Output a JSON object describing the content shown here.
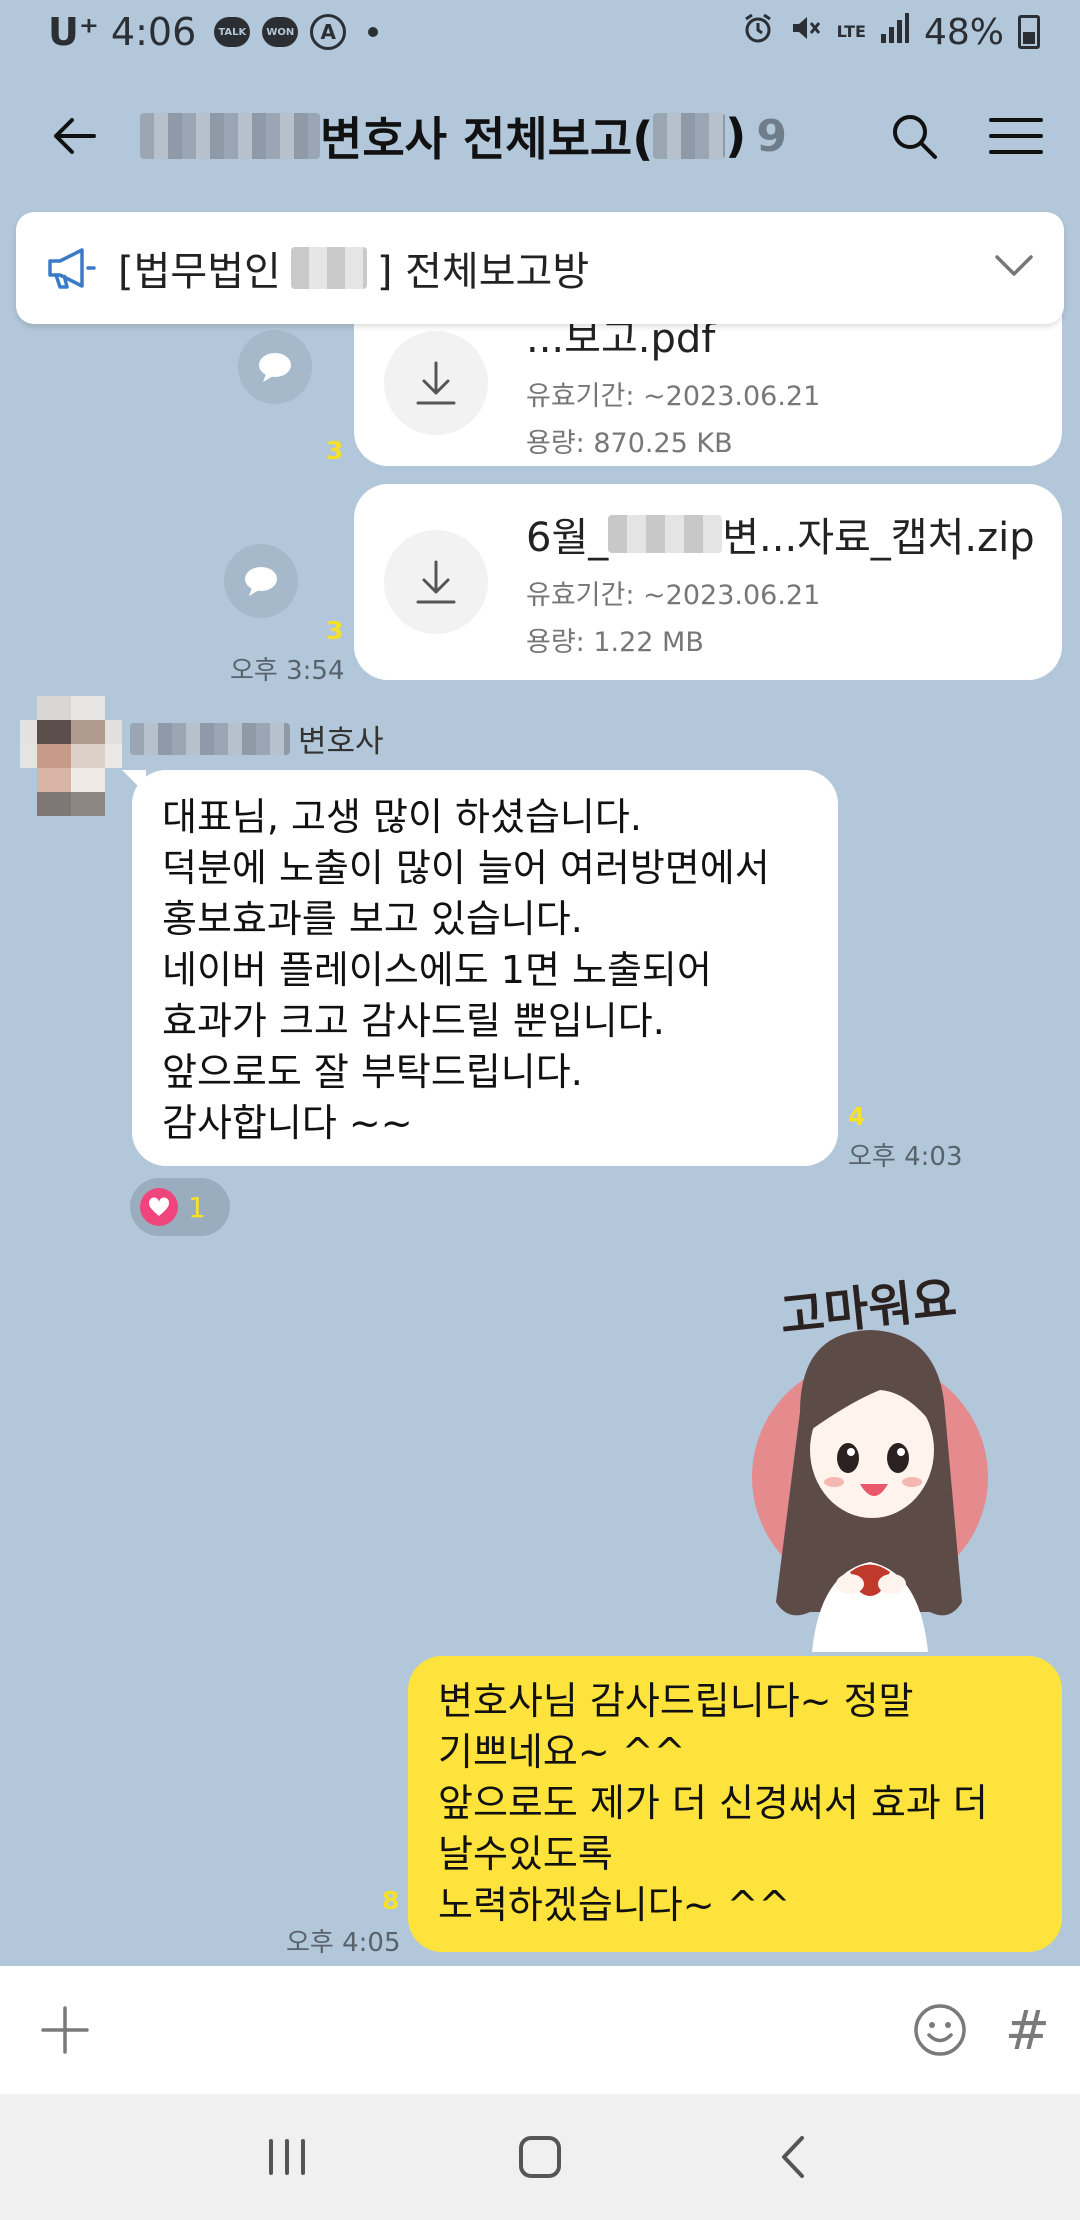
{
  "status": {
    "carrier": "U⁺",
    "time": "4:06",
    "talk_icon_label": "TALK",
    "won_icon_label": "WON",
    "a_icon_label": "A",
    "network": "LTE",
    "battery": "48%",
    "icons": [
      "alarm-icon",
      "mute-icon",
      "signal-icon",
      "battery-icon"
    ]
  },
  "header": {
    "title": "변호사 전체보고(",
    "title_close": ")",
    "member_count": "9",
    "icons": [
      "back-arrow-icon",
      "search-icon",
      "menu-icon"
    ]
  },
  "notice": {
    "prefix": "[법무법인",
    "suffix": "] 전체보고방",
    "icons": [
      "megaphone-icon",
      "chevron-down-icon"
    ]
  },
  "messages": {
    "file1": {
      "name_tail": "...보고.pdf",
      "expiry": "유효기간: ~2023.06.21",
      "size": "용량: 870.25 KB",
      "unread": "3"
    },
    "file2": {
      "name_prefix": "6월_",
      "name_suffix": "변...자료_캡처.zip",
      "expiry": "유효기간: ~2023.06.21",
      "size": "용량: 1.22 MB",
      "unread": "3",
      "time": "오후 3:54"
    },
    "incoming": {
      "sender_suffix": "변호사",
      "lines": [
        "대표님, 고생 많이 하셨습니다.",
        "덕분에 노출이 많이 늘어 여러방면에서",
        "홍보효과를 보고 있습니다.",
        "네이버 플레이스에도 1면 노출되어",
        "효과가 크고 감사드릴 뿐입니다.",
        "앞으로도 잘 부탁드립니다.",
        "감사합니다 ~~"
      ],
      "unread": "4",
      "time": "오후 4:03",
      "reaction_count": "1"
    },
    "sticker": {
      "text": "고마워요"
    },
    "outgoing": {
      "lines": [
        "변호사님 감사드립니다~ 정말",
        "기쁘네요~ ^^",
        "앞으로도 제가 더 신경써서 효과 더",
        "날수있도록",
        "노력하겠습니다~ ^^"
      ],
      "unread": "8",
      "time": "오후 4:05"
    }
  },
  "input": {
    "placeholder": "",
    "hash_label": "#"
  },
  "colors": {
    "background": "#b2c7d9",
    "outgoing_bubble": "#fee33c",
    "incoming_bubble": "#ffffff",
    "unread": "#f5e02a",
    "reaction_heart": "#f0457c"
  }
}
